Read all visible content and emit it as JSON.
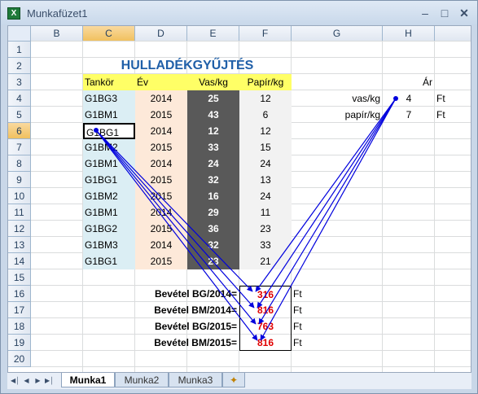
{
  "window": {
    "title": "Munkafüzet1"
  },
  "columns": [
    "B",
    "C",
    "D",
    "E",
    "F",
    "G",
    "H"
  ],
  "rows": [
    "1",
    "2",
    "3",
    "4",
    "5",
    "6",
    "7",
    "8",
    "9",
    "10",
    "11",
    "12",
    "13",
    "14",
    "15",
    "16",
    "17",
    "18",
    "19",
    "20"
  ],
  "sheet": {
    "title": "HULLADÉKGYŰJTÉS",
    "headers": {
      "tankor": "Tankör",
      "ev": "Év",
      "vas": "Vas/kg",
      "papir": "Papír/kg"
    },
    "records": [
      {
        "tankor": "G1BG3",
        "ev": "2014",
        "vas": "25",
        "papir": "12"
      },
      {
        "tankor": "G1BM1",
        "ev": "2015",
        "vas": "43",
        "papir": "6"
      },
      {
        "tankor": "G1BG1",
        "ev": "2014",
        "vas": "12",
        "papir": "12"
      },
      {
        "tankor": "G1BM2",
        "ev": "2015",
        "vas": "33",
        "papir": "15"
      },
      {
        "tankor": "G1BM1",
        "ev": "2014",
        "vas": "24",
        "papir": "24"
      },
      {
        "tankor": "G1BG1",
        "ev": "2015",
        "vas": "32",
        "papir": "13"
      },
      {
        "tankor": "G1BM2",
        "ev": "2015",
        "vas": "16",
        "papir": "24"
      },
      {
        "tankor": "G1BM1",
        "ev": "2014",
        "vas": "29",
        "papir": "11"
      },
      {
        "tankor": "G1BG2",
        "ev": "2015",
        "vas": "36",
        "papir": "23"
      },
      {
        "tankor": "G1BM3",
        "ev": "2014",
        "vas": "32",
        "papir": "33"
      },
      {
        "tankor": "G1BG1",
        "ev": "2015",
        "vas": "23",
        "papir": "21"
      }
    ],
    "price": {
      "header": "Ár",
      "rows": [
        {
          "label": "vas/kg",
          "value": "4",
          "unit": "Ft"
        },
        {
          "label": "papír/kg",
          "value": "7",
          "unit": "Ft"
        }
      ]
    },
    "revenue": [
      {
        "label": "Bevétel BG/2014=",
        "value": "316",
        "unit": "Ft"
      },
      {
        "label": "Bevétel BM/2014=",
        "value": "816",
        "unit": "Ft"
      },
      {
        "label": "Bevétel BG/2015=",
        "value": "763",
        "unit": "Ft"
      },
      {
        "label": "Bevétel BM/2015=",
        "value": "816",
        "unit": "Ft"
      }
    ]
  },
  "tabs": [
    "Munka1",
    "Munka2",
    "Munka3"
  ],
  "colors": {
    "tankor_bg": "#dbeef4",
    "ev_bg": "#fde9d9",
    "vas_bg": "#595959",
    "papir_bg": "#f2f2f2",
    "header_bg": "#ffff66",
    "title": "#1f5fa8",
    "revenue": "#e00000",
    "arrow": "#0000dd"
  }
}
